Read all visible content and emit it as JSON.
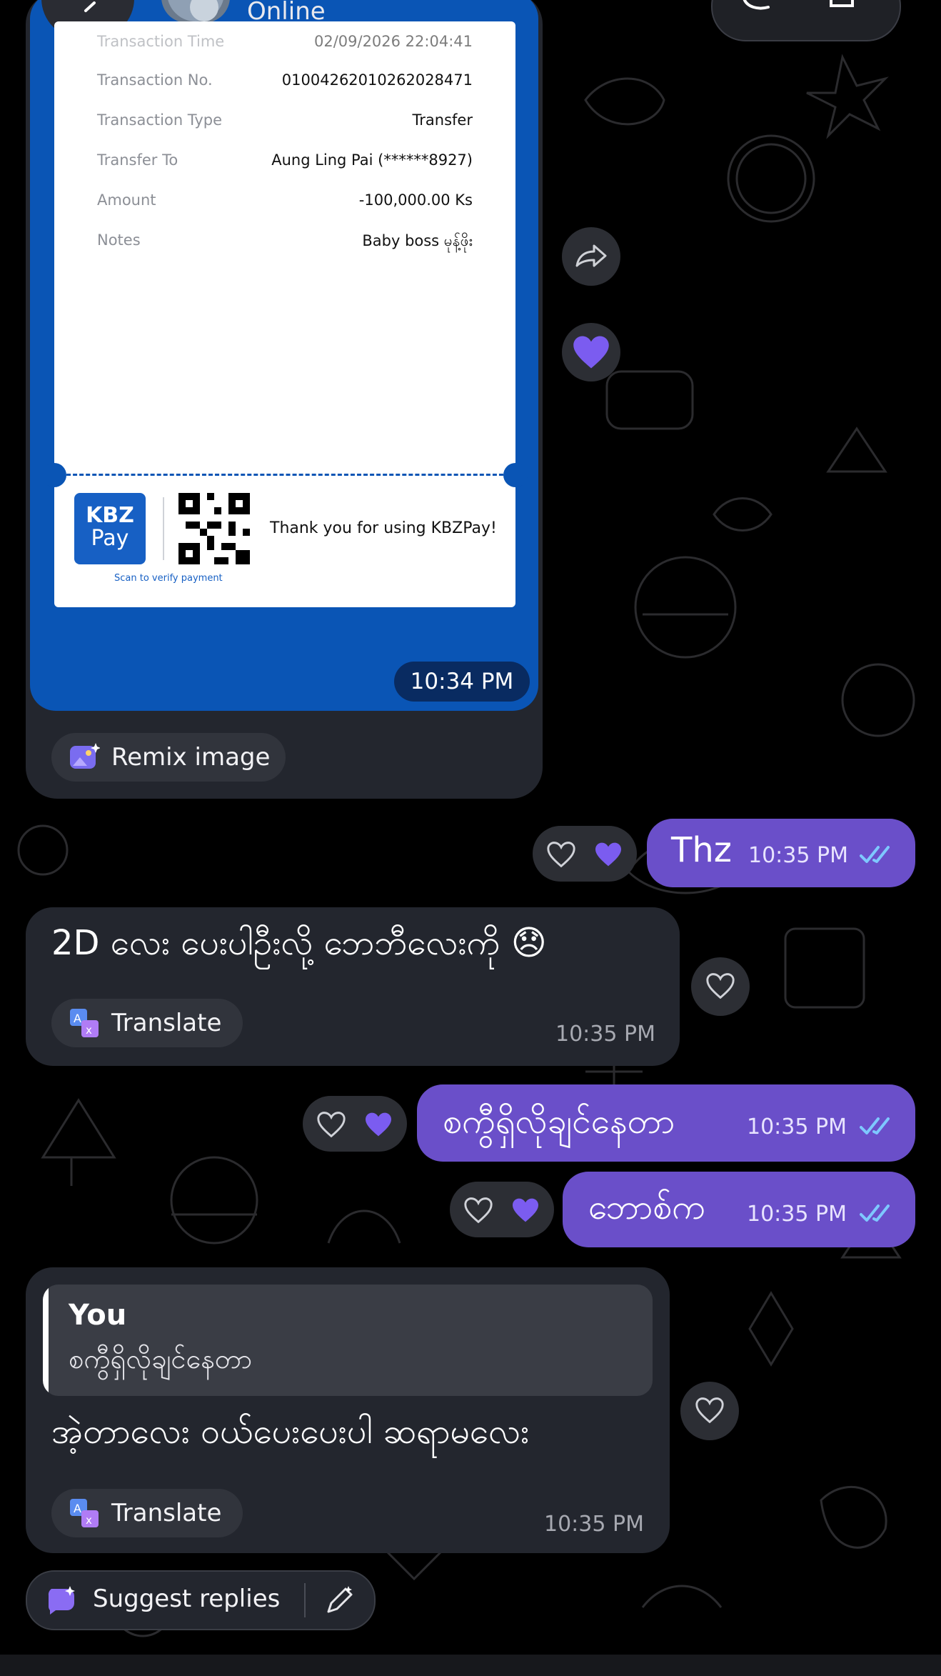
{
  "header": {
    "status": "Online"
  },
  "receipt": {
    "time_label": "Transaction Time",
    "time_value": "02/09/2026 22:04:41",
    "rows": [
      {
        "label": "Transaction No.",
        "value": "01004262010262028471"
      },
      {
        "label": "Transaction Type",
        "value": "Transfer"
      },
      {
        "label": "Transfer To",
        "value": "Aung Ling Pai (******8927)"
      },
      {
        "label": "Amount",
        "value": "-100,000.00 Ks"
      },
      {
        "label": "Notes",
        "value": "Baby boss မုန့်ဖိုး"
      }
    ],
    "logo_line1": "KBZ",
    "logo_line2": "Pay",
    "scan_text": "Scan to verify payment",
    "thanks": "Thank you for using KBZPay!",
    "time": "10:34 PM",
    "remix_label": "Remix image"
  },
  "messages": [
    {
      "dir": "out",
      "text": "Thz",
      "time": "10:35 PM"
    },
    {
      "dir": "in",
      "text": "2D လေး ပေးပါဦးလို့ ဘေဘီလေးကို 😞",
      "time": "10:35 PM",
      "action": "Translate"
    },
    {
      "dir": "out",
      "text": "စကွီရှိလိုချင်နေတာ",
      "time": "10:35 PM"
    },
    {
      "dir": "out",
      "text": "ဘောစ်က",
      "time": "10:35 PM"
    },
    {
      "dir": "in",
      "quote_author": "You",
      "quote_text": "စကွီရှိလိုချင်နေတာ",
      "text": "အဲ့တာလေး ဝယ်ပေးပေးပါ ဆရာမလေး",
      "time": "10:35 PM",
      "action": "Translate"
    }
  ],
  "suggest": {
    "label": "Suggest replies"
  },
  "colors": {
    "outgoing": "#6a4fc9",
    "incoming": "#23262e",
    "receipt_blue": "#0a55b5",
    "read_tick": "#7ec8ff"
  },
  "icons": [
    "back-icon",
    "phone-icon",
    "video-icon",
    "forward-icon",
    "heart-icon",
    "heart-outline-icon",
    "double-check-icon",
    "translate-icon",
    "remix-icon",
    "sparkle-icon",
    "edit-pen-icon"
  ]
}
